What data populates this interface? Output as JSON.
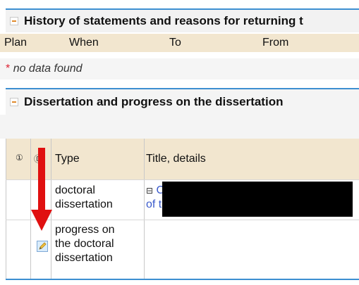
{
  "history": {
    "title": "History of statements and reasons for returning t",
    "columns": [
      "Plan",
      "When",
      "To",
      "From"
    ],
    "empty_star": "*",
    "empty_text": "no data found"
  },
  "dissertation": {
    "title": "Dissertation and progress on the dissertation",
    "columns": {
      "help_icon": "①",
      "type": "Type",
      "title": "Title, details"
    },
    "rows": [
      {
        "type": "doctoral dissertation",
        "type_line1": "doctoral",
        "type_line2": "dissertation",
        "title_prefix": "⊟",
        "title_line1": "C",
        "title_line2": "of t"
      },
      {
        "type_line1": "progress on",
        "type_line2": "the doctoral",
        "type_line3": "dissertation",
        "icon": "edit-icon"
      }
    ]
  },
  "colors": {
    "section_border": "#3d8fd1",
    "column_header_bg": "#f2e6cf",
    "section_head_bg": "#f2f2f2",
    "arrow": "#e01010",
    "link": "#3b5bcc"
  }
}
